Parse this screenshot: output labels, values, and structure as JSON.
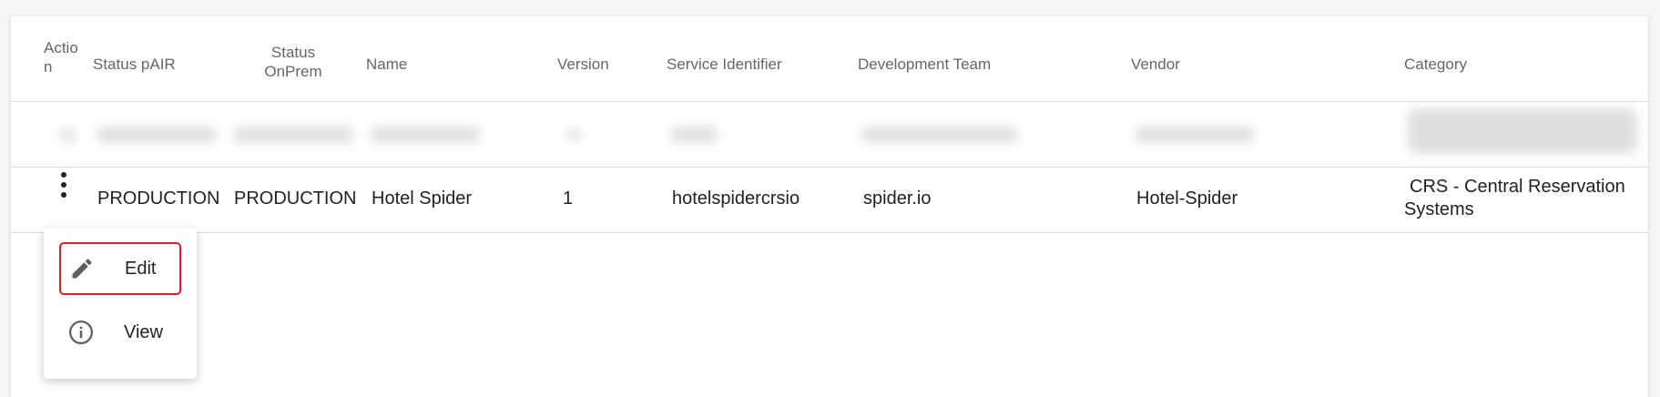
{
  "table": {
    "headers": {
      "action": "Actio n",
      "status_pair": "Status pAIR",
      "status_onprem_line1": "Status",
      "status_onprem_line2": "OnPrem",
      "name": "Name",
      "version": "Version",
      "service_identifier": "Service Identifier",
      "development_team": "Development Team",
      "vendor": "Vendor",
      "category": "Category"
    },
    "row": {
      "status_pair": "PRODUCTION",
      "status_onprem": "PRODUCTION",
      "name": "Hotel Spider",
      "version": "1",
      "service_identifier": "hotelspidercrsio",
      "development_team": "spider.io",
      "vendor": "Hotel-Spider",
      "category_line1": "CRS - Central Reservation",
      "category_line2": "Systems"
    }
  },
  "action_menu": {
    "icons": {
      "edit": "pencil-icon",
      "view": "info-icon"
    },
    "items": [
      {
        "label": "Edit",
        "highlighted": true
      },
      {
        "label": "View",
        "highlighted": false
      }
    ],
    "highlight_color": "#e02020"
  }
}
